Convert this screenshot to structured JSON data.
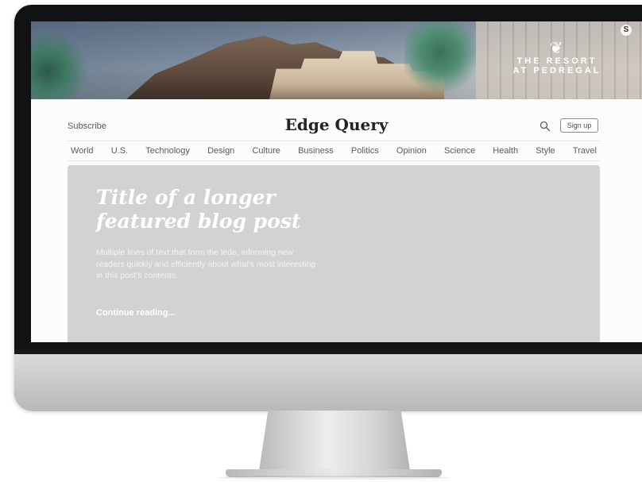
{
  "ad": {
    "logo_line1": "THE RESORT",
    "logo_line2": "AT PEDREGAL",
    "badge_icon": "sponsored-s-icon"
  },
  "header": {
    "subscribe_label": "Subscribe",
    "site_title": "Edge Query",
    "search_icon": "search-icon",
    "signup_label": "Sign up"
  },
  "nav": {
    "items": [
      "World",
      "U.S.",
      "Technology",
      "Design",
      "Culture",
      "Business",
      "Politics",
      "Opinion",
      "Science",
      "Health",
      "Style",
      "Travel"
    ]
  },
  "hero": {
    "title": "Title of a longer featured blog post",
    "lede": "Multiple lines of text that form the lede, informing new readers quickly and efficiently about what's most interesting in this post's contents.",
    "continue_label": "Continue reading..."
  },
  "colors": {
    "hero_bg": "#d2d2d4",
    "monitor_bezel": "#111214",
    "chin": "#c6c7c9"
  }
}
